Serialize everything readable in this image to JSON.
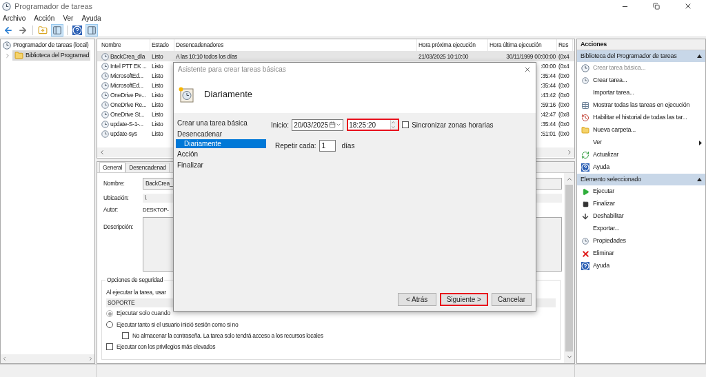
{
  "window": {
    "title": "Programador de tareas"
  },
  "menu": [
    "Archivo",
    "Acción",
    "Ver",
    "Ayuda"
  ],
  "toolbar": [
    {
      "selected": false
    },
    {
      "selected": false
    },
    {
      "selected": false
    },
    {
      "selected": true
    },
    {
      "selected": false
    },
    {
      "selected": true
    }
  ],
  "tree": [
    {
      "label": "Programador de tareas (local)",
      "selected": false,
      "children": [
        {
          "label": "Biblioteca del Programad",
          "selected": true,
          "expanded": false
        }
      ]
    }
  ],
  "table": {
    "columns": [
      "Nombre",
      "Estado",
      "Desencadenadores",
      "Hora próxima ejecución",
      "Hora última ejecución",
      "Res"
    ],
    "rows": [
      {
        "name": "BackCrea_día",
        "status": "Listo",
        "trigger": "A las 10:10 todos los días",
        "next_run": "21/03/2025 10:10:00",
        "last_run": "30/11/1999 00:00:00",
        "result": "(0x4",
        "selected": true
      },
      {
        "name": "Intel PTT EK ...",
        "status": "Listo",
        "last_run": ":00:00",
        "result": "(0x4",
        "selected": false
      },
      {
        "name": "MicrosoftEd...",
        "status": "Listo",
        "last_run": ":35:44",
        "result": "(0x0",
        "selected": false
      },
      {
        "name": "MicrosoftEd...",
        "status": "Listo",
        "last_run": ":35:44",
        "result": "(0x0",
        "selected": false
      },
      {
        "name": "OneDrive Pe...",
        "status": "Listo",
        "last_run": ":43:42",
        "result": "(0x0",
        "selected": false
      },
      {
        "name": "OneDrive Re...",
        "status": "Listo",
        "last_run": ":59:16",
        "result": "(0x0",
        "selected": false
      },
      {
        "name": "OneDrive St...",
        "status": "Listo",
        "last_run": ":42:47",
        "result": "(0x8",
        "selected": false
      },
      {
        "name": "update-S-1-...",
        "status": "Listo",
        "last_run": ":35:44",
        "result": "(0x0",
        "selected": false
      },
      {
        "name": "update-sys",
        "status": "Listo",
        "last_run": ":51:01",
        "result": "(0x0",
        "selected": false
      }
    ]
  },
  "details": {
    "tabs": [
      {
        "label": "General",
        "selected": true
      },
      {
        "label": "Desencadenad",
        "selected": false
      }
    ],
    "name_label": "Nombre:",
    "name_value": "BackCrea_",
    "location_label": "Ubicación:",
    "location_value": "\\",
    "author_label": "Autor:",
    "author_value": "DESKTOP-",
    "description_label": "Descripción:",
    "security": {
      "title": "Opciones de seguridad",
      "run_as_label": "Al ejecutar la tarea, usar",
      "user": "SOPORTE",
      "options": [
        {
          "kind": "radio",
          "label": "Ejecutar solo cuando",
          "checked": true,
          "disabled": true
        },
        {
          "kind": "radio",
          "label": "Ejecutar tanto si el usuario inició sesión como si no",
          "checked": false,
          "disabled": false,
          "children": [
            {
              "kind": "checkbox",
              "label": "No almacenar la contraseña. La tarea solo tendrá acceso a los recursos locales",
              "checked": false,
              "disabled": false
            }
          ]
        },
        {
          "kind": "checkbox",
          "label": "Ejecutar con los privilegios más elevados",
          "checked": false,
          "disabled": false
        }
      ]
    }
  },
  "actions": {
    "title": "Acciones",
    "sections": [
      {
        "title": "Biblioteca del Programador de tareas",
        "expanded": true,
        "items": [
          {
            "label": "Crear tarea básica...",
            "disabled": true
          },
          {
            "label": "Crear tarea...",
            "disabled": false
          },
          {
            "label": "Importar tarea...",
            "disabled": false
          },
          {
            "label": "Mostrar todas las tareas en ejecución",
            "disabled": false
          },
          {
            "label": "Habilitar el historial de todas las tar...",
            "disabled": false
          },
          {
            "label": "Nueva carpeta...",
            "disabled": false
          },
          {
            "label": "Ver",
            "disabled": false,
            "submenu": true
          },
          {
            "label": "Actualizar",
            "disabled": false
          },
          {
            "label": "Ayuda",
            "disabled": false
          }
        ]
      },
      {
        "title": "Elemento seleccionado",
        "expanded": true,
        "items": [
          {
            "label": "Ejecutar",
            "disabled": false
          },
          {
            "label": "Finalizar",
            "disabled": false
          },
          {
            "label": "Deshabilitar",
            "disabled": false
          },
          {
            "label": "Exportar...",
            "disabled": false
          },
          {
            "label": "Propiedades",
            "disabled": false
          },
          {
            "label": "Eliminar",
            "disabled": false
          },
          {
            "label": "Ayuda",
            "disabled": false
          }
        ]
      }
    ]
  },
  "dialog": {
    "title": "Asistente para crear tareas básicas",
    "heading": "Diariamente",
    "steps": [
      {
        "label": "Crear una tarea básica",
        "selected": false
      },
      {
        "label": "Desencadenar",
        "selected": false,
        "children": [
          {
            "label": "Diariamente",
            "selected": true
          }
        ]
      },
      {
        "label": "Acción",
        "selected": false
      },
      {
        "label": "Finalizar",
        "selected": false
      }
    ],
    "start_label": "Inicio:",
    "start_date": "20/03/2025",
    "start_time": "18:25:20",
    "time_highlighted": true,
    "sync": {
      "label": "Sincronizar zonas horarias",
      "checked": false
    },
    "repeat_label": "Repetir cada:",
    "repeat_value": "1",
    "repeat_unit": "días",
    "buttons": [
      {
        "label": "< Atrás",
        "highlighted": false
      },
      {
        "label": "Siguiente >",
        "highlighted": true
      },
      {
        "label": "Cancelar",
        "highlighted": false
      }
    ]
  }
}
